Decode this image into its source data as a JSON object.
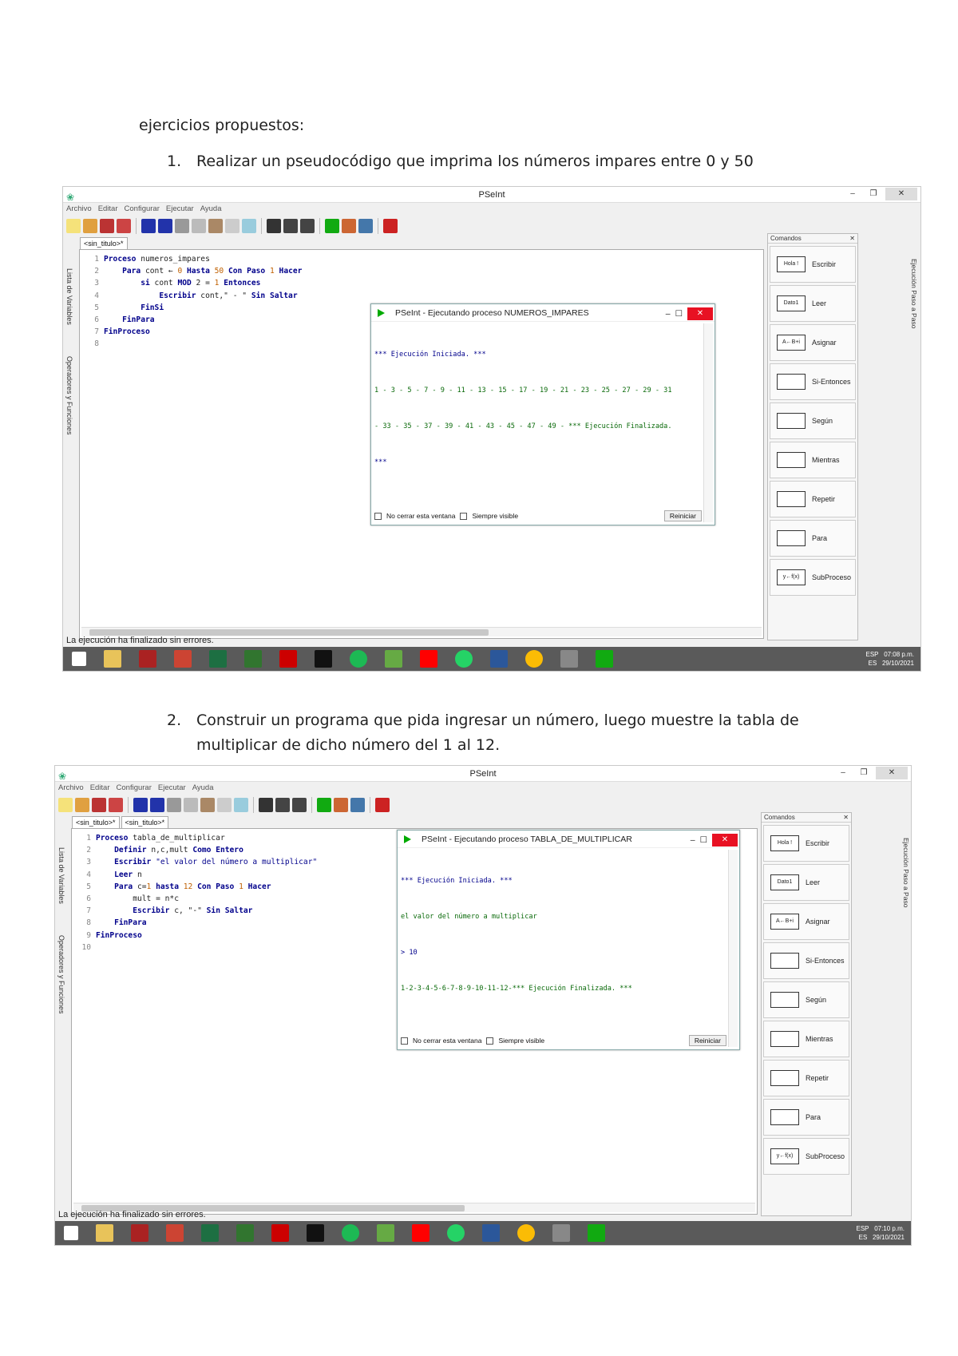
{
  "doc": {
    "heading": "ejercicios propuestos:",
    "item1_num": "1.",
    "item1_text": "Realizar un pseudocódigo que imprima los números impares entre 0 y 50",
    "item2_num": "2.",
    "item2_line1": "Construir un programa que pida ingresar un número, luego muestre la tabla de",
    "item2_line2": "multiplicar de dicho número  del 1 al 12."
  },
  "app": {
    "title": "PSeInt",
    "menu": [
      "Archivo",
      "Editar",
      "Configurar",
      "Ejecutar",
      "Ayuda"
    ],
    "left_tab_vars": "Lista de Variables",
    "left_tab_ops": "Operadores y Funciones",
    "right_strip": "Ejecución Paso a Paso",
    "commands_title": "Comandos",
    "commands": [
      "Escribir",
      "Leer",
      "Asignar",
      "Si-Entonces",
      "Según",
      "Mientras",
      "Repetir",
      "Para",
      "SubProceso"
    ],
    "cmd_icon_text": [
      "Hola !",
      "Dato1",
      "A←B+i",
      "",
      "",
      "",
      "",
      "",
      "y←f(x)"
    ],
    "status": "La ejecución ha finalizado sin errores.",
    "no_cerrar": "No cerrar esta ventana",
    "siempre_visible": "Siempre visible",
    "reiniciar": "Reiniciar",
    "tray_lang1": "ESP",
    "tray_lang2": "ES"
  },
  "shot1": {
    "tab": "<sin_titulo>*",
    "code_nums": [
      "1",
      "2",
      "3",
      "4",
      "5",
      "6",
      "7",
      "8"
    ],
    "run_title": "PSeInt - Ejecutando proceso NUMEROS_IMPARES",
    "run_lines": [
      "*** Ejecución Iniciada. ***",
      "1 - 3 - 5 - 7 - 9 - 11 - 13 - 15 - 17 - 19 - 21 - 23 - 25 - 27 - 29 - 31",
      "- 33 - 35 - 37 - 39 - 41 - 43 - 45 - 47 - 49 - *** Ejecución Finalizada.",
      "***"
    ],
    "time": "07:08 p.m.",
    "date": "29/10/2021"
  },
  "shot2": {
    "tab1": "<sin_titulo>*",
    "tab2": "<sin_titulo>*",
    "code_nums": [
      "1",
      "2",
      "3",
      "4",
      "5",
      "6",
      "7",
      "8",
      "9",
      "10"
    ],
    "run_title": "PSeInt - Ejecutando proceso TABLA_DE_MULTIPLICAR",
    "run_lines": [
      "*** Ejecución Iniciada. ***",
      "el valor del número a multiplicar",
      "> 10",
      "1-2-3-4-5-6-7-8-9-10-11-12-*** Ejecución Finalizada. ***"
    ],
    "time": "07:10 p.m.",
    "date": "29/10/2021"
  },
  "code1": {
    "l1a": "Proceso",
    "l1b": " numeros_impares",
    "l2a": "Para",
    "l2b": " cont ← ",
    "l2c": "0",
    "l2d": " Hasta ",
    "l2e": "50",
    "l2f": " Con Paso ",
    "l2g": "1",
    "l2h": " Hacer",
    "l3a": "si",
    "l3b": " cont ",
    "l3c": "MOD",
    "l3d": " 2 = ",
    "l3e": "1",
    "l3f": " Entonces",
    "l4a": "Escribir",
    "l4b": " cont,\" - \" ",
    "l4c": "Sin Saltar",
    "l5": "FinSi",
    "l6": "FinPara",
    "l7": "FinProceso"
  },
  "code2": {
    "l1a": "Proceso",
    "l1b": " tabla_de_multiplicar",
    "l2a": "Definir",
    "l2b": " n,c,mult ",
    "l2c": "Como Entero",
    "l3a": "Escribir",
    "l3b": " \"el valor del número a multiplicar\"",
    "l4a": "Leer",
    "l4b": " n",
    "l5a": "Para",
    "l5b": " c=",
    "l5c": "1",
    "l5d": " hasta ",
    "l5e": "12",
    "l5f": " Con Paso ",
    "l5g": "1",
    "l5h": " Hacer",
    "l6": "mult = n*c",
    "l7a": "Escribir",
    "l7b": " c, \"-\" ",
    "l7c": "Sin Saltar",
    "l8": "FinPara",
    "l9": "FinProceso"
  },
  "colors": {
    "keyword": "#00008b",
    "number": "#c06000",
    "output_green": "#0a6a0a",
    "taskbar": "#5a5a5a",
    "close_red": "#e81123"
  }
}
